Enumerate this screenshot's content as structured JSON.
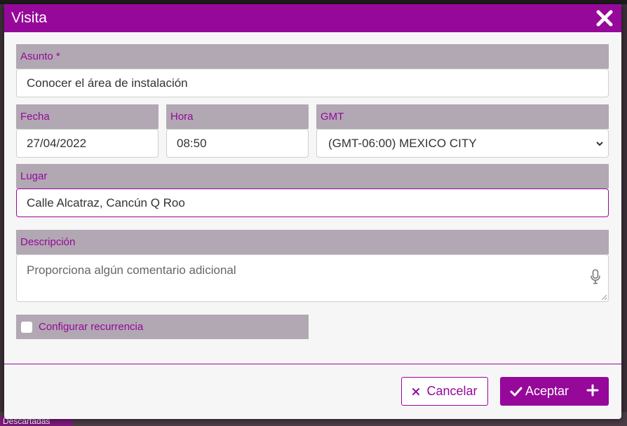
{
  "modal": {
    "title": "Visita"
  },
  "form": {
    "asunto": {
      "label": "Asunto *",
      "value": "Conocer el área de instalación"
    },
    "fecha": {
      "label": "Fecha",
      "value": "27/04/2022"
    },
    "hora": {
      "label": "Hora",
      "value": "08:50"
    },
    "gmt": {
      "label": "GMT",
      "value": "(GMT-06:00) MEXICO CITY"
    },
    "lugar": {
      "label": "Lugar",
      "value": "Calle Alcatraz, Cancún Q Roo"
    },
    "descripcion": {
      "label": "Descripción",
      "placeholder": "Proporciona algún comentario adicional"
    },
    "recurrencia": {
      "label": "Configurar recurrencia",
      "checked": false
    }
  },
  "buttons": {
    "cancel": "Cancelar",
    "accept": "Aceptar"
  },
  "background": {
    "tag": "Descartadas"
  },
  "colors": {
    "accent": "#96089a",
    "label_bg": "#b1a8b3"
  },
  "icons": [
    "close-icon",
    "chevron-down-icon",
    "microphone-icon",
    "x-icon",
    "check-icon",
    "plus-icon"
  ]
}
